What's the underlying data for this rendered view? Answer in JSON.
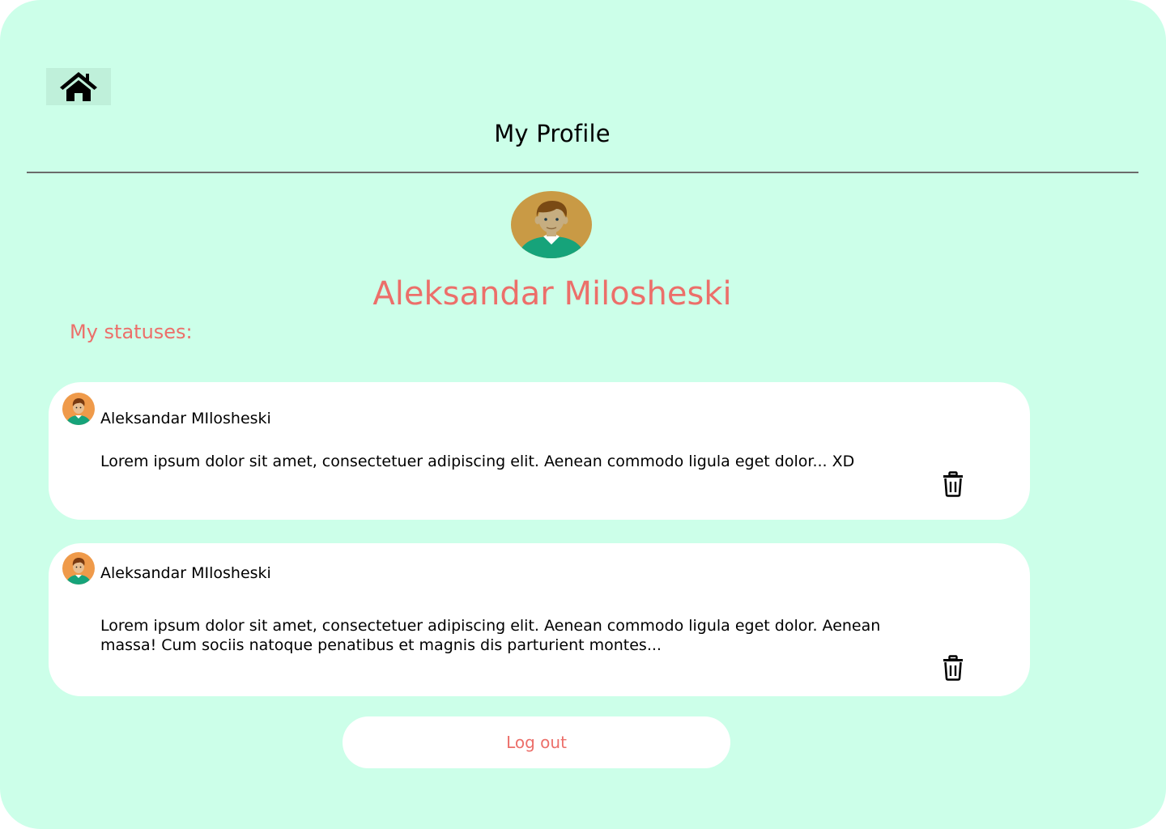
{
  "header": {
    "home_icon": "home-icon",
    "title": "My Profile"
  },
  "profile": {
    "avatar_icon": "user-avatar",
    "name": "Aleksandar Milosheski",
    "statuses_heading": "My statuses:"
  },
  "statuses": [
    {
      "author": "Aleksandar MIlosheski",
      "text": "Lorem ipsum dolor sit amet, consectetuer adipiscing elit. Aenean commodo ligula eget dolor... XD",
      "delete_icon": "trash-icon"
    },
    {
      "author": "Aleksandar MIlosheski",
      "text": "Lorem ipsum dolor sit amet, consectetuer adipiscing elit. Aenean commodo ligula eget dolor. Aenean massa!  Cum sociis natoque penatibus et magnis dis parturient montes...",
      "delete_icon": "trash-icon"
    }
  ],
  "actions": {
    "logout_label": "Log out"
  },
  "colors": {
    "background": "#ccffe9",
    "accent": "#ec6f6a",
    "card": "#ffffff"
  }
}
